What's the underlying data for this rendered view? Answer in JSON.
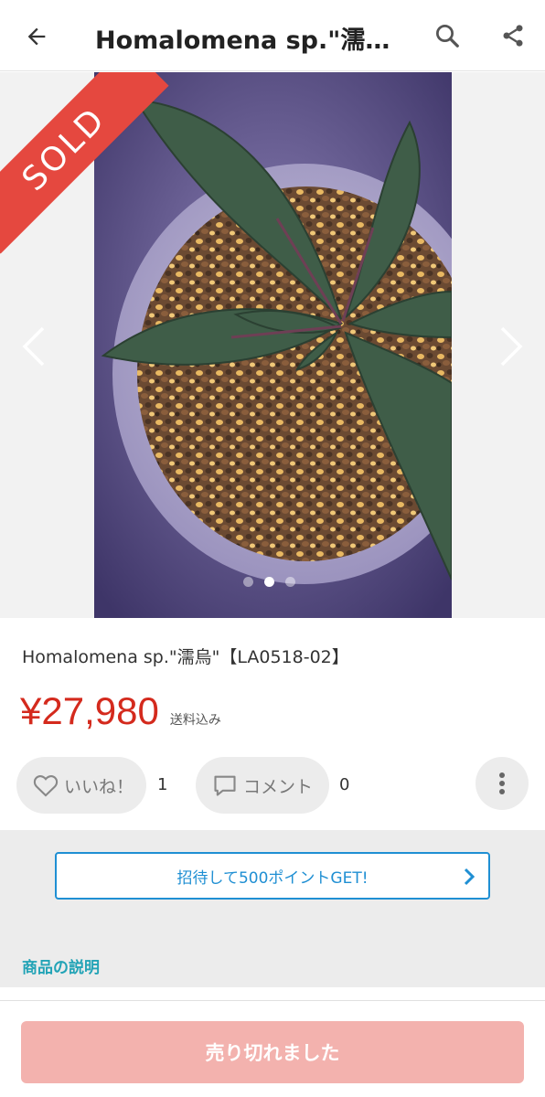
{
  "header": {
    "title": "Homalomena sp.\"濡烏\"…",
    "back_icon": "arrow-left-icon",
    "search_icon": "search-icon",
    "share_icon": "share-icon"
  },
  "gallery": {
    "sold_badge": "SOLD",
    "prev_icon": "chevron-left-icon",
    "next_icon": "chevron-right-icon",
    "page_count": 3,
    "current_page": 2,
    "image_description_icon": "plant-photo"
  },
  "product": {
    "name": "Homalomena sp.\"濡烏\"【LA0518-02】",
    "price": "¥27,980",
    "shipping": "送料込み"
  },
  "actions": {
    "like_label": "いいね！",
    "like_count": "1",
    "comment_label": "コメント",
    "comment_count": "0",
    "more_icon": "more-vertical-icon"
  },
  "invite": {
    "label": "招待して500ポイントGET!"
  },
  "description": {
    "section_title": "商品の説明"
  },
  "footer": {
    "soldout_label": "売り切れました"
  },
  "colors": {
    "price": "#d42a1d",
    "sold_ribbon": "#e5483f",
    "invite_accent": "#1f8fd3",
    "section_title": "#22a3b6",
    "soldout_button": "#f3b2ae"
  }
}
